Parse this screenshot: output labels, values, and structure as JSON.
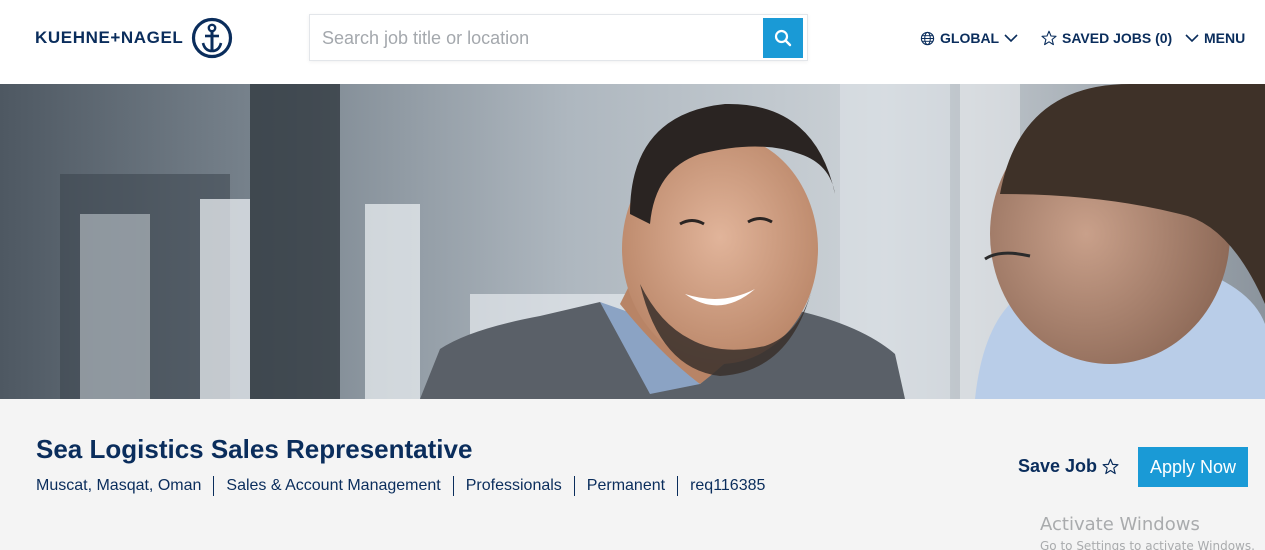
{
  "header": {
    "logo_text": "KUEHNE+NAGEL",
    "search_placeholder": "Search job title or location",
    "nav": {
      "global_label": "GLOBAL",
      "saved_jobs_label": "SAVED JOBS (0)",
      "menu_label": "MENU"
    }
  },
  "colors": {
    "brand_navy": "#0a2d5c",
    "accent_blue": "#1a9ad6",
    "band_background": "#f4f4f4"
  },
  "job": {
    "title": "Sea Logistics Sales Representative",
    "meta": [
      "Muscat, Masqat, Oman",
      "Sales & Account Management",
      "Professionals",
      "Permanent",
      "req116385"
    ],
    "save_label": "Save Job",
    "apply_label": "Apply Now"
  },
  "watermark": {
    "line1": "Activate Windows",
    "line2": "Go to Settings to activate Windows."
  },
  "icons": [
    "anchor-icon",
    "search-icon",
    "globe-icon",
    "chevron-down-icon",
    "star-icon"
  ]
}
